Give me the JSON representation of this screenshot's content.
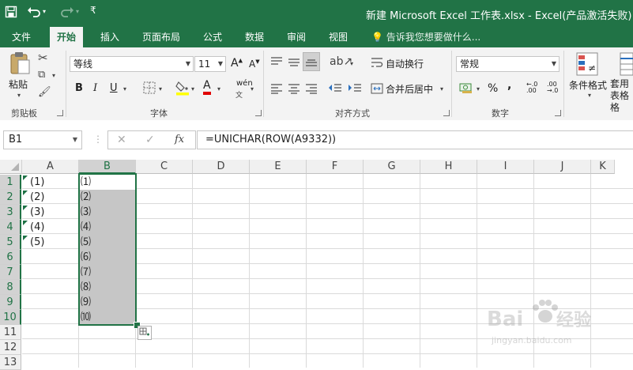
{
  "quick_access": {
    "save_icon": "save-icon",
    "undo_icon": "undo-icon",
    "redo_icon": "redo-icon",
    "customize_icon": "customize-icon"
  },
  "window_title": "新建 Microsoft Excel 工作表.xlsx - Excel(产品激活失败)",
  "tabs": [
    "文件",
    "开始",
    "插入",
    "页面布局",
    "公式",
    "数据",
    "审阅",
    "视图"
  ],
  "active_tab": "开始",
  "tell_me": "告诉我您想要做什么...",
  "ribbon": {
    "clipboard": {
      "paste": "粘贴",
      "label": "剪贴板"
    },
    "font": {
      "name": "等线",
      "size": "11",
      "grow": "A",
      "shrink": "A",
      "bold": "B",
      "italic": "I",
      "underline": "U",
      "font_color": "A",
      "phonetic": "wén",
      "label": "字体"
    },
    "alignment": {
      "wrap": "自动换行",
      "merge": "合并后居中",
      "label": "对齐方式"
    },
    "number": {
      "format": "常规",
      "percent": "%",
      "comma": ",",
      "inc_decimal": "←.0 .00",
      "dec_decimal": ".00 →.0",
      "label": "数字"
    },
    "styles": {
      "conditional": "条件格式",
      "table": "套用 表格格"
    }
  },
  "name_box": "B1",
  "formula_bar": {
    "cancel": "✕",
    "enter": "✓",
    "fx": "fx",
    "formula": "=UNICHAR(ROW(A9332))"
  },
  "columns": [
    "A",
    "B",
    "C",
    "D",
    "E",
    "F",
    "G",
    "H",
    "I",
    "J",
    "K"
  ],
  "selected_column": "B",
  "rows": [
    "1",
    "2",
    "3",
    "4",
    "5",
    "6",
    "7",
    "8",
    "9",
    "10",
    "11",
    "12",
    "13"
  ],
  "col_a": [
    "(1)",
    "(2)",
    "(3)",
    "(4)",
    "(5)"
  ],
  "col_b": [
    "⑴",
    "⑵",
    "⑶",
    "⑷",
    "⑸",
    "⑹",
    "⑺",
    "⑻",
    "⑼",
    "⑽"
  ],
  "colors": {
    "excel_green": "#217346",
    "selection_fill": "#c6c6c6",
    "error_flag": "#1e7145"
  },
  "watermark": {
    "brand": "Baidu经验",
    "url": "jingyan.baidu.com"
  }
}
